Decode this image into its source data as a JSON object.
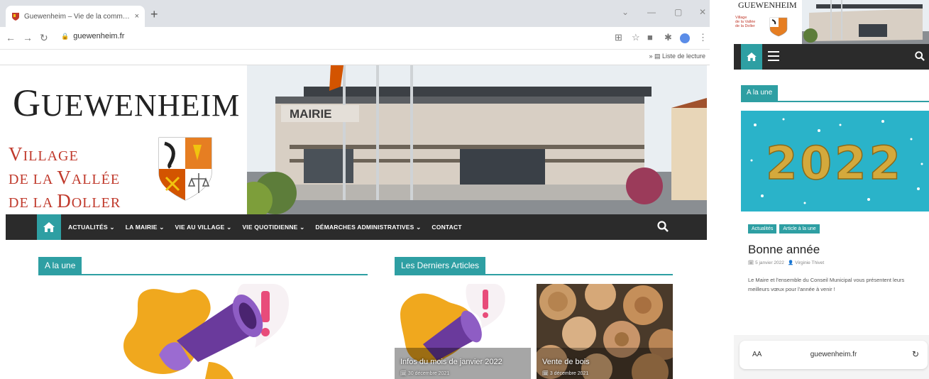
{
  "browser": {
    "tab_title": "Guewenheim – Vie de la comm…",
    "tab_close": "×",
    "new_tab": "+",
    "url": "guewenheim.fr",
    "reading_list": "Liste de lecture"
  },
  "site": {
    "name_first": "G",
    "name_rest": "UEWENHEIM",
    "tagline": [
      {
        "cap": "V",
        "rest": "ILLAGE"
      },
      {
        "pre": "DE LA ",
        "cap": "V",
        "rest": "ALLÉE"
      },
      {
        "pre": "DE LA ",
        "cap": "D",
        "rest": "OLLER"
      }
    ],
    "building_sign": "MAIRIE"
  },
  "nav": {
    "items": [
      "ACTUALITÉS ⌄",
      "LA MAIRIE ⌄",
      "VIE AU VILLAGE ⌄",
      "VIE QUOTIDIENNE ⌄",
      "DÉMARCHES ADMINISTRATIVES ⌄",
      "CONTACT"
    ]
  },
  "content": {
    "featured_heading": "A la une",
    "latest_heading": "Les Derniers Articles",
    "cards": [
      {
        "title": "Infos du mois de janvier 2022",
        "date": "30 décembre 2021"
      },
      {
        "title": "Vente de bois",
        "date": "3 décembre 2021"
      }
    ]
  },
  "mobile": {
    "logo": "GUEWENHEIM",
    "tagline": [
      "Village",
      "de la Vallée",
      "de la Doller"
    ],
    "section": "A la une",
    "image_text": "2022",
    "tags": [
      "Actualités",
      "Article à la une"
    ],
    "post_title": "Bonne année",
    "post_date": "5 janvier 2022",
    "post_author": "Virginie Thivet",
    "excerpt": "Le Maire et l'ensemble du Conseil Municipal vous présentent leurs meilleurs vœux pour l'année à venir !",
    "aa": "AA",
    "url": "guewenheim.fr"
  },
  "colors": {
    "accent": "#2e9fa3",
    "nav_bg": "#2b2b2b",
    "tagline_red": "#c0392b"
  }
}
